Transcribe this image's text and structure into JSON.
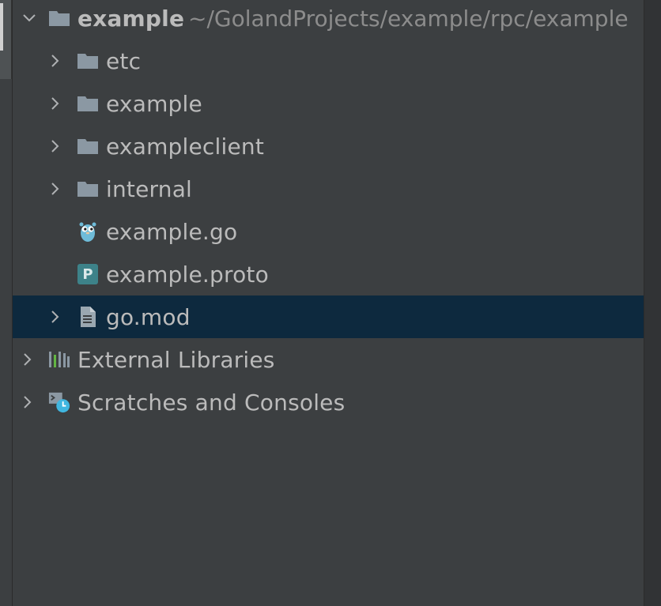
{
  "tree": {
    "root": {
      "label": "example",
      "path": "~/GolandProjects/example/rpc/example",
      "icon": "folder-icon",
      "expanded": true
    },
    "children": [
      {
        "label": "etc",
        "icon": "folder-icon",
        "expandable": true
      },
      {
        "label": "example",
        "icon": "folder-icon",
        "expandable": true
      },
      {
        "label": "exampleclient",
        "icon": "folder-icon",
        "expandable": true
      },
      {
        "label": "internal",
        "icon": "folder-icon",
        "expandable": true
      },
      {
        "label": "example.go",
        "icon": "gopher-icon",
        "expandable": false
      },
      {
        "label": "example.proto",
        "icon": "proto-file-icon",
        "badge": "P",
        "expandable": false
      },
      {
        "label": "go.mod",
        "icon": "file-text-icon",
        "expandable": true,
        "selected": true
      }
    ],
    "top_level": [
      {
        "label": "External Libraries",
        "icon": "libraries-icon",
        "expandable": true
      },
      {
        "label": "Scratches and Consoles",
        "icon": "scratches-icon",
        "expandable": true
      }
    ]
  },
  "colors": {
    "background": "#3c3f41",
    "selection": "#0d293e",
    "text": "#bbbbbb",
    "path_text": "#8c8c8c",
    "folder": "#8b98a3",
    "proto_badge": "#3d8289",
    "gopher": "#6fbcd9"
  }
}
